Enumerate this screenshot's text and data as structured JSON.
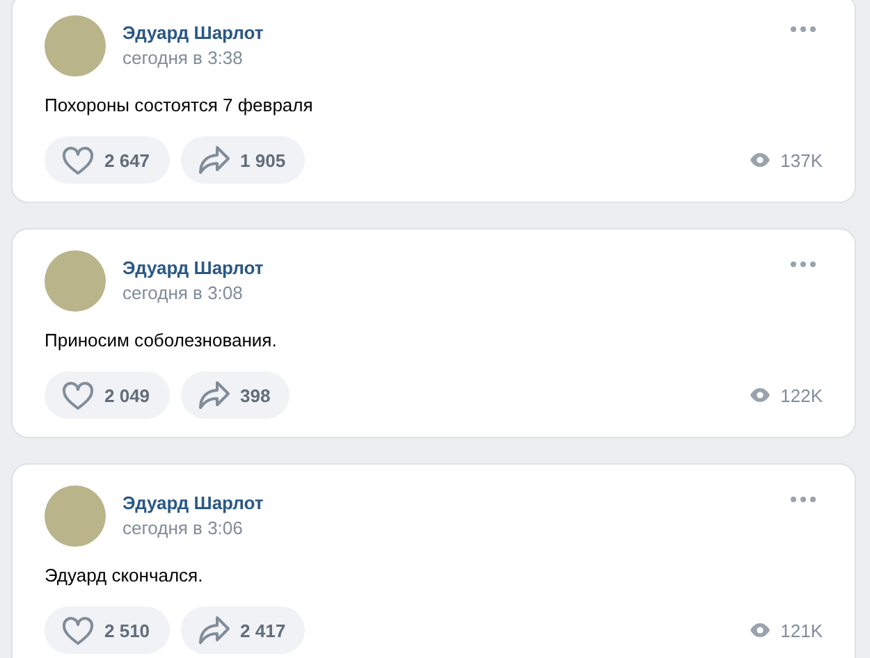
{
  "posts": [
    {
      "author": "Эдуард Шарлот",
      "time": "сегодня в 3:38",
      "text": "Похороны состоятся 7 февраля",
      "likes": "2 647",
      "shares": "1 905",
      "views": "137K"
    },
    {
      "author": "Эдуард Шарлот",
      "time": "сегодня в 3:08",
      "text": "Приносим соболезнования.",
      "likes": "2 049",
      "shares": "398",
      "views": "122K"
    },
    {
      "author": "Эдуард Шарлот",
      "time": "сегодня в 3:06",
      "text": "Эдуард скончался.",
      "likes": "2 510",
      "shares": "2 417",
      "views": "121K"
    }
  ]
}
